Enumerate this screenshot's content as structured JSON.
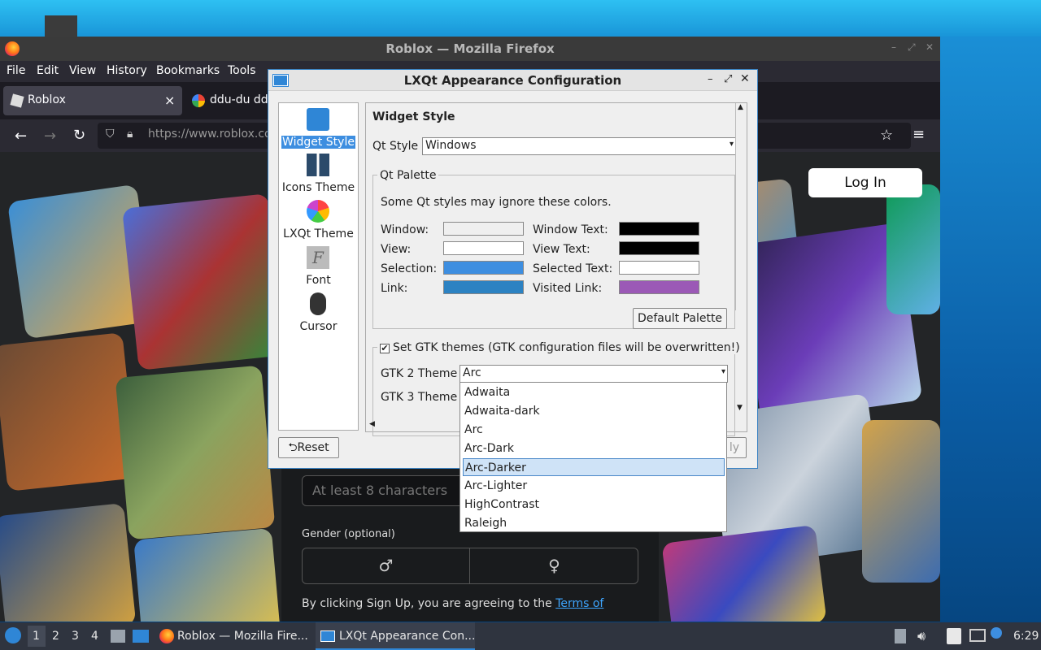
{
  "firefox": {
    "title": "Roblox — Mozilla Firefox",
    "menu": [
      "File",
      "Edit",
      "View",
      "History",
      "Bookmarks",
      "Tools"
    ],
    "tabs": [
      {
        "label": "Roblox",
        "close": "×"
      },
      {
        "label": "ddu-du dd"
      }
    ],
    "url": "https://www.roblox.co",
    "page": {
      "login": "Log In",
      "password_placeholder": "At least 8 characters",
      "gender_label": "Gender (optional)",
      "terms_text": "By clicking Sign Up, you are agreeing to the ",
      "terms_link": "Terms of"
    }
  },
  "dialog": {
    "title": "LXQt Appearance Configuration",
    "sidebar": [
      {
        "label": "Widget Style",
        "icon": "widget-style-icon"
      },
      {
        "label": "Icons Theme",
        "icon": "icons-theme-icon"
      },
      {
        "label": "LXQt Theme",
        "icon": "lxqt-theme-icon"
      },
      {
        "label": "Font",
        "icon": "font-icon"
      },
      {
        "label": "Cursor",
        "icon": "cursor-icon"
      }
    ],
    "heading": "Widget Style",
    "qt_style_label": "Qt Style",
    "qt_style_value": "Windows",
    "palette_group": "Qt Palette",
    "palette_note": "Some Qt styles may ignore these colors.",
    "palette": {
      "window": {
        "label": "Window:",
        "color": "#efefef"
      },
      "view": {
        "label": "View:",
        "color": "#ffffff"
      },
      "selection": {
        "label": "Selection:",
        "color": "#3d8ee0"
      },
      "link": {
        "label": "Link:",
        "color": "#2c82c2"
      },
      "window_text": {
        "label": "Window Text:",
        "color": "#000000"
      },
      "view_text": {
        "label": "View Text:",
        "color": "#000000"
      },
      "selected_text": {
        "label": "Selected Text:",
        "color": "#ffffff"
      },
      "visited_link": {
        "label": "Visited Link:",
        "color": "#9b59b6"
      }
    },
    "default_palette": "Default Palette",
    "gtk_checkbox": "Set GTK themes (GTK configuration files will be overwritten!)",
    "gtk2_label": "GTK 2 Theme",
    "gtk2_value": "Arc",
    "gtk3_label": "GTK 3 Theme",
    "gtk2_options": [
      "Adwaita",
      "Adwaita-dark",
      "Arc",
      "Arc-Dark",
      "Arc-Darker",
      "Arc-Lighter",
      "HighContrast",
      "Raleigh"
    ],
    "gtk2_highlighted": "Arc-Darker",
    "reset": "Reset",
    "apply_partial": "ly"
  },
  "taskbar": {
    "workspaces": [
      "1",
      "2",
      "3",
      "4"
    ],
    "tasks": [
      {
        "label": "Roblox — Mozilla Fire..."
      },
      {
        "label": "LXQt Appearance Con..."
      }
    ],
    "clock": "6:29"
  }
}
